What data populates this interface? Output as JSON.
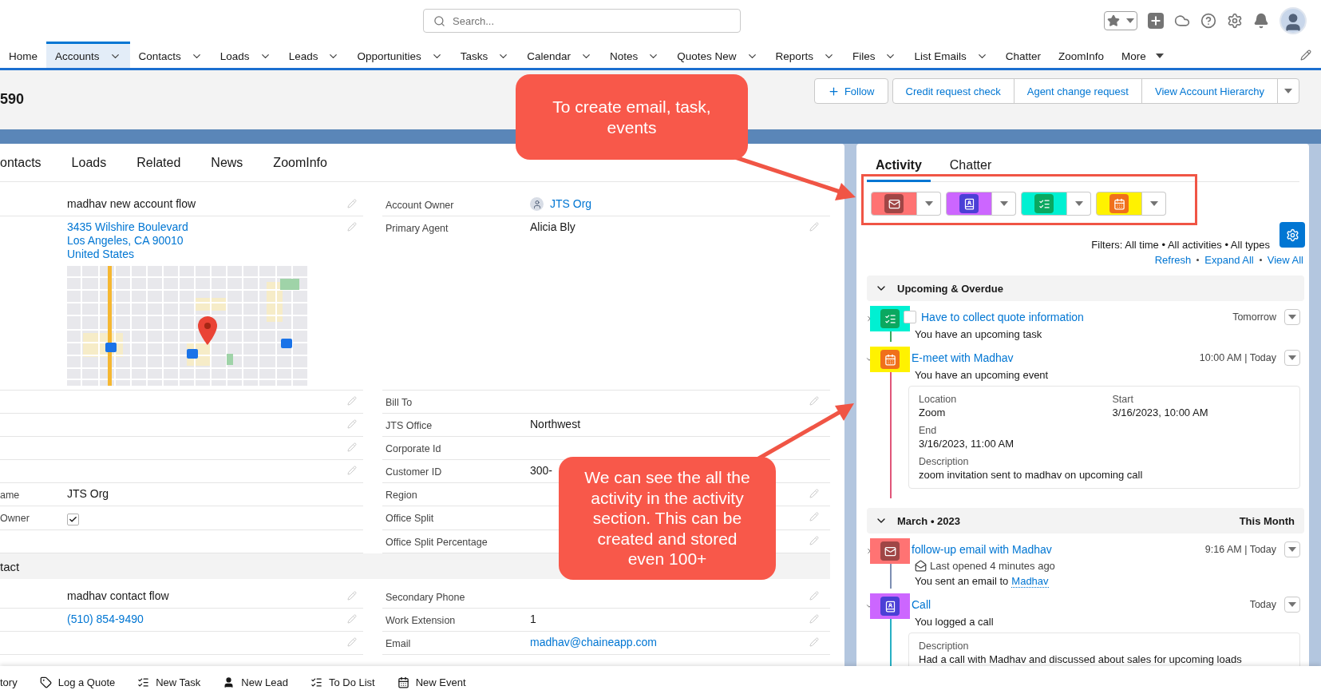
{
  "header": {
    "search": {
      "placeholder": "Search..."
    }
  },
  "nav": {
    "items": [
      {
        "label": "Home",
        "kind": "plain",
        "selected": false
      },
      {
        "label": "Accounts",
        "kind": "menu",
        "selected": true
      },
      {
        "label": "Contacts",
        "kind": "menu",
        "selected": false
      },
      {
        "label": "Loads",
        "kind": "menu",
        "selected": false
      },
      {
        "label": "Leads",
        "kind": "menu",
        "selected": false
      },
      {
        "label": "Opportunities",
        "kind": "menu",
        "selected": false
      },
      {
        "label": "Tasks",
        "kind": "menu",
        "selected": false
      },
      {
        "label": "Calendar",
        "kind": "menu",
        "selected": false
      },
      {
        "label": "Notes",
        "kind": "menu",
        "selected": false
      },
      {
        "label": "Quotes New",
        "kind": "menu",
        "selected": false
      },
      {
        "label": "Reports",
        "kind": "menu",
        "selected": false
      },
      {
        "label": "Files",
        "kind": "menu",
        "selected": false
      },
      {
        "label": "List Emails",
        "kind": "menu",
        "selected": false
      },
      {
        "label": "Chatter",
        "kind": "plain",
        "selected": false
      },
      {
        "label": "ZoomInfo",
        "kind": "plain",
        "selected": false
      },
      {
        "label": "More",
        "kind": "more",
        "selected": false
      }
    ]
  },
  "page_header": {
    "title": "590",
    "buttons": [
      {
        "label": "Follow"
      },
      {
        "label": "Credit request check"
      },
      {
        "label": "Agent change request"
      },
      {
        "label": "View Account Hierarchy"
      }
    ]
  },
  "detail": {
    "tabs": [
      {
        "label": "ontacts",
        "selected": false
      },
      {
        "label": "Loads",
        "selected": false
      },
      {
        "label": "Related",
        "selected": false
      },
      {
        "label": "News",
        "selected": false
      },
      {
        "label": "ZoomInfo",
        "selected": false
      }
    ],
    "sections": [
      {
        "rows": [
          {
            "left": {
              "kind": "text",
              "value": "madhav new account flow",
              "editable": true
            },
            "right": {
              "label": "Account Owner",
              "kind": "user",
              "value": "JTS Org",
              "editable": false
            }
          },
          {
            "left": {
              "kind": "address",
              "lines": [
                "3435 Wilshire Boulevard",
                "Los Angeles, CA 90010",
                "United States"
              ],
              "editable": true
            },
            "right": {
              "label": "Primary Agent",
              "kind": "text",
              "value": "Alicia Bly",
              "editable": true
            }
          },
          {
            "left": {
              "kind": "empty",
              "editable": true
            },
            "right": {
              "label": "Bill To",
              "kind": "empty",
              "editable": true
            }
          },
          {
            "left": {
              "kind": "empty",
              "editable": true
            },
            "right": {
              "label": "JTS Office",
              "kind": "text",
              "value": "Northwest",
              "editable": false
            }
          },
          {
            "left": {
              "kind": "empty",
              "editable": true
            },
            "right": {
              "label": "Corporate Id",
              "kind": "empty",
              "editable": false
            }
          },
          {
            "left": {
              "kind": "empty",
              "editable": true
            },
            "right": {
              "label": "Customer ID",
              "kind": "text",
              "value": "300-",
              "editable": false
            }
          },
          {
            "left": {
              "label": "ame",
              "kind": "text",
              "value": "JTS Org",
              "editable": false
            },
            "right": {
              "label": "Region",
              "kind": "empty",
              "editable": true
            }
          },
          {
            "left": {
              "label": "Owner",
              "kind": "checkbox",
              "checked": true,
              "editable": false
            },
            "right": {
              "label": "Office Split",
              "kind": "empty",
              "editable": true
            }
          },
          {
            "left": {
              "kind": "empty",
              "editable": false
            },
            "right": {
              "label": "Office Split Percentage",
              "kind": "empty",
              "editable": true
            }
          }
        ]
      },
      {
        "title": "tact",
        "rows": [
          {
            "left": {
              "kind": "text",
              "value": "madhav contact flow",
              "editable": true
            },
            "right": {
              "label": "Secondary Phone",
              "kind": "empty",
              "editable": true
            }
          },
          {
            "left": {
              "kind": "link",
              "value": "(510) 854-9490",
              "editable": true
            },
            "right": {
              "label": "Work Extension",
              "kind": "text",
              "value": "1",
              "editable": true
            }
          },
          {
            "left": {
              "kind": "empty",
              "editable": true
            },
            "right": {
              "label": "Email",
              "kind": "link",
              "value": "madhav@chaineapp.com",
              "editable": true
            }
          }
        ]
      }
    ]
  },
  "activity": {
    "tabs": [
      {
        "label": "Activity",
        "selected": true
      },
      {
        "label": "Chatter",
        "selected": false
      }
    ],
    "actions": [
      {
        "kind": "email",
        "color": "#ff7373"
      },
      {
        "kind": "call",
        "color": "#cc66ff"
      },
      {
        "kind": "task",
        "color": "#00f0d2"
      },
      {
        "kind": "event",
        "color": "#fff200"
      }
    ],
    "filters": "Filters: All time • All activities • All types",
    "links": [
      "Refresh",
      "Expand All",
      "View All"
    ],
    "groups": [
      {
        "title": "Upcoming & Overdue",
        "items": [
          {
            "kind": "task",
            "color": "#00f0d2",
            "expanded": false,
            "checked": false,
            "title": "Have to collect quote information",
            "when": "Tomorrow",
            "lines": [
              "You have an upcoming task"
            ]
          },
          {
            "kind": "event",
            "color": "#fff200",
            "expanded": true,
            "title": "E-meet with Madhav",
            "when": "10:00 AM | Today",
            "lines": [
              "You have an upcoming event"
            ],
            "details": [
              {
                "label": "Location",
                "value": "Zoom"
              },
              {
                "label": "Start",
                "value": "3/16/2023, 10:00 AM"
              },
              {
                "label": "End",
                "value": "3/16/2023, 11:00 AM"
              },
              {
                "label": "Description",
                "value": "zoom invitation sent to madhav on upcoming call"
              }
            ]
          }
        ]
      },
      {
        "title": "March • 2023",
        "badge": "This Month",
        "items": [
          {
            "kind": "email",
            "color": "#ff7373",
            "expanded": false,
            "title": "follow-up email with Madhav",
            "when": "9:16 AM | Today",
            "opened": "Last opened 4 minutes ago",
            "sent": {
              "text": "You sent an email to",
              "link": "Madhav"
            }
          },
          {
            "kind": "call",
            "color": "#cc66ff",
            "expanded": true,
            "title": "Call",
            "when": "Today",
            "lines": [
              "You logged a call"
            ],
            "details": [
              {
                "label": "Description",
                "value": "Had a call with Madhav and discussed about sales for upcoming loads"
              }
            ]
          }
        ]
      }
    ]
  },
  "utility_bar": {
    "items": [
      {
        "label": "tory"
      },
      {
        "label": "Log a Quote"
      },
      {
        "label": "New Task"
      },
      {
        "label": "New Lead"
      },
      {
        "label": "To Do List"
      },
      {
        "label": "New Event"
      }
    ]
  },
  "annotations": [
    {
      "text": "To create email, task, events"
    },
    {
      "text": "We can see the all the activity in the activity section. This can be created and stored even 100+"
    }
  ]
}
